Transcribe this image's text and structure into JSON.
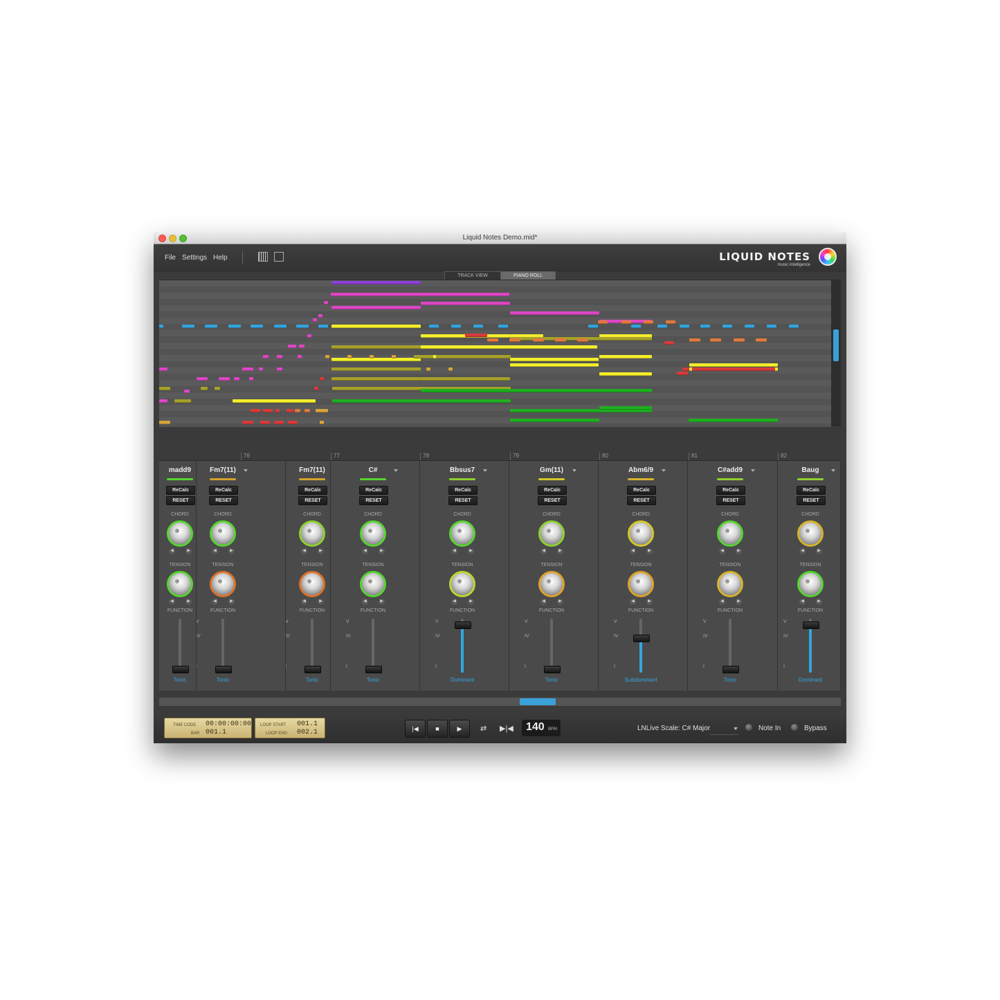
{
  "window": {
    "title": "Liquid Notes Demo.mid*"
  },
  "menu": {
    "file": "File",
    "settings": "Settings",
    "help": "Help"
  },
  "logo": {
    "name": "LIQUID NOTES",
    "tagline": "music intelligence"
  },
  "tabs": [
    {
      "label": "TRACK VIEW",
      "active": false
    },
    {
      "label": "PIANO ROLL",
      "active": true
    }
  ],
  "ruler": {
    "bars": [
      "76",
      "77",
      "78",
      "79",
      "80",
      "81",
      "82"
    ]
  },
  "labels": {
    "recalc": "ReCalc",
    "reset": "RESET",
    "chord": "CHORD",
    "tension": "TENSION",
    "function": "FUNCTION",
    "v": "V",
    "iv": "IV",
    "i": "I"
  },
  "lanes": [
    {
      "chord": "madd9",
      "indicator": "#55d62f",
      "chord_ring": "#55d62f",
      "tension_ring": "#55d62f",
      "function": "Tonic",
      "fader_level": 0.0
    },
    {
      "chord": "Fm7(11)",
      "indicator": "#d6a22a",
      "chord_ring": "#55d62f",
      "tension_ring": "#e0702a",
      "function": "Tonic",
      "fader_level": 0.0
    },
    {
      "chord": "Fm7(11)",
      "indicator": "#d6a22a",
      "chord_ring": "#8fd12f",
      "tension_ring": "#e0702a",
      "function": "Tonic",
      "fader_level": 0.0
    },
    {
      "chord": "C#",
      "indicator": "#55d62f",
      "chord_ring": "#55d62f",
      "tension_ring": "#55d62f",
      "function": "Tonic",
      "fader_level": 0.0
    },
    {
      "chord": "Bbsus7",
      "indicator": "#8fd12f",
      "chord_ring": "#55d62f",
      "tension_ring": "#bcd62f",
      "function": "Dominant",
      "fader_level": 1.0
    },
    {
      "chord": "Gm(11)",
      "indicator": "#d6c72a",
      "chord_ring": "#8fd12f",
      "tension_ring": "#e0a22a",
      "function": "Tonic",
      "fader_level": 0.0
    },
    {
      "chord": "Abm6/9",
      "indicator": "#d6b32a",
      "chord_ring": "#d6c72a",
      "tension_ring": "#e0a22a",
      "function": "Subdominant",
      "fader_level": 0.7
    },
    {
      "chord": "C#add9",
      "indicator": "#8fd12f",
      "chord_ring": "#55d62f",
      "tension_ring": "#d6b32a",
      "function": "Tonic",
      "fader_level": 0.0
    },
    {
      "chord": "Baug",
      "indicator": "#8fd12f",
      "chord_ring": "#d6b32a",
      "tension_ring": "#55d62f",
      "function": "Dominant",
      "fader_level": 1.0
    }
  ],
  "transport": {
    "time_code_label": "TIME CODE",
    "time_code": "00:00:00:00",
    "bar_label": "BAR",
    "bar": "001.1",
    "loop_start_label": "LOOP START",
    "loop_start": "001.1",
    "loop_end_label": "LOOP END",
    "loop_end": "002.1",
    "bpm": "140",
    "bpm_unit": "BPM",
    "scale_label": "LNLive Scale: C# Major",
    "note_in": "Note In",
    "bypass": "Bypass"
  },
  "colors": {
    "accent": "#33a6e0",
    "yellow": "#f4ee2c",
    "olive": "#a6a12a",
    "green": "#1fb01f",
    "magenta": "#dd46c4",
    "cyan": "#34a3dc",
    "orange": "#e07a3e",
    "red": "#d83a3a",
    "purple": "#8a3fd6",
    "gold": "#d8a53a"
  }
}
